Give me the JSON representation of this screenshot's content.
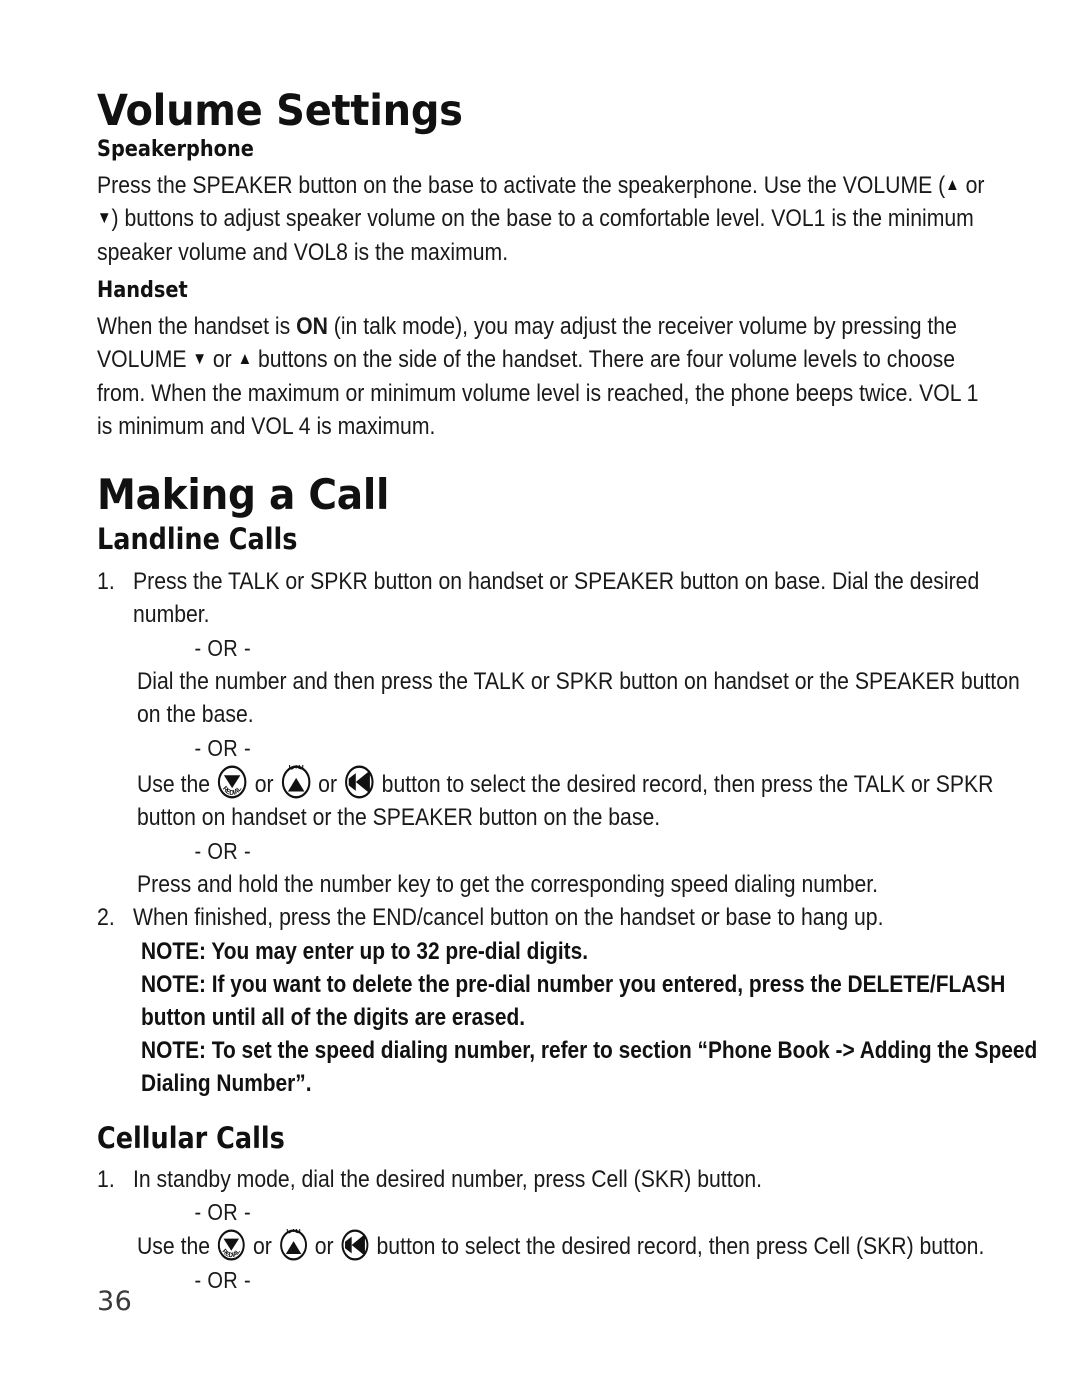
{
  "page": {
    "folio": "36"
  },
  "sections": {
    "volume_settings": {
      "title": "Volume Settings",
      "speakerphone": {
        "heading": "Speakerphone",
        "text_part1": "Press the SPEAKER button on the base to activate the speakerphone. Use the VOLUME (",
        "glyph_up": "▲",
        "text_mid": " or ",
        "glyph_down": "▼",
        "text_part2": ") buttons to adjust speaker volume on the base to a comfortable level. VOL1 is the minimum speaker volume and VOL8 is the maximum."
      },
      "handset": {
        "heading": "Handset",
        "text_part1": "When the handset is ",
        "bold_on": "ON",
        "text_part2": " (in talk mode), you may adjust the receiver volume by pressing the VOLUME ",
        "glyph_down": "▼",
        "text_mid": " or ",
        "glyph_up": "▲",
        "text_part3": " buttons on the side of the handset. There are four volume levels to choose from. When the maximum or minimum volume level is reached, the phone beeps twice. VOL 1 is minimum and VOL 4 is maximum."
      }
    },
    "making_a_call": {
      "title": "Making a Call",
      "landline": {
        "heading": "Landline Calls",
        "item1_num": "1.",
        "item1_text": "Press the TALK or SPKR button on handset or SPEAKER button on base. Dial the desired number.",
        "or_1": "- OR -",
        "alt1_text": "Dial the number and then press the TALK or SPKR button on handset or the SPEAKER button on the base.",
        "or_2": "- OR -",
        "alt2_prefix": "Use the ",
        "alt2_join_a": " or ",
        "alt2_join_b": " or ",
        "alt2_suffix": " button to select the desired record, then press the TALK or SPKR button on handset or the SPEAKER button on the base.",
        "or_3": "- OR -",
        "alt3_text": "Press and hold the number key to get the corresponding speed dialing number.",
        "item2_num": "2.",
        "item2_text": "When finished, press the END/cancel button on the handset or base to hang up.",
        "note1": "NOTE: You may enter up to 32 pre-dial digits.",
        "note2": "NOTE: If you want to delete the pre-dial number you entered, press the DELETE/FLASH button until all of the digits are erased.",
        "note3": "NOTE: To set the speed dialing number, refer to section “Phone Book -> Adding the Speed Dialing Number”."
      },
      "cellular": {
        "heading": "Cellular Calls",
        "item1_num": "1.",
        "item1_text": "In standby mode, dial the desired number, press Cell (SKR) button.",
        "or_1": "- OR -",
        "alt1_prefix": "Use the ",
        "alt1_join_a": " or ",
        "alt1_join_b": " or ",
        "alt1_suffix": " button to select the desired record, then press Cell (SKR) button.",
        "or_2": "- OR -"
      }
    }
  },
  "icons": {
    "redial": {
      "label": "REDIAL",
      "name": "redial-button-icon"
    },
    "cid": {
      "label": "CID",
      "name": "cid-button-icon"
    },
    "left": {
      "label": "",
      "name": "left-arrow-button-icon"
    }
  }
}
